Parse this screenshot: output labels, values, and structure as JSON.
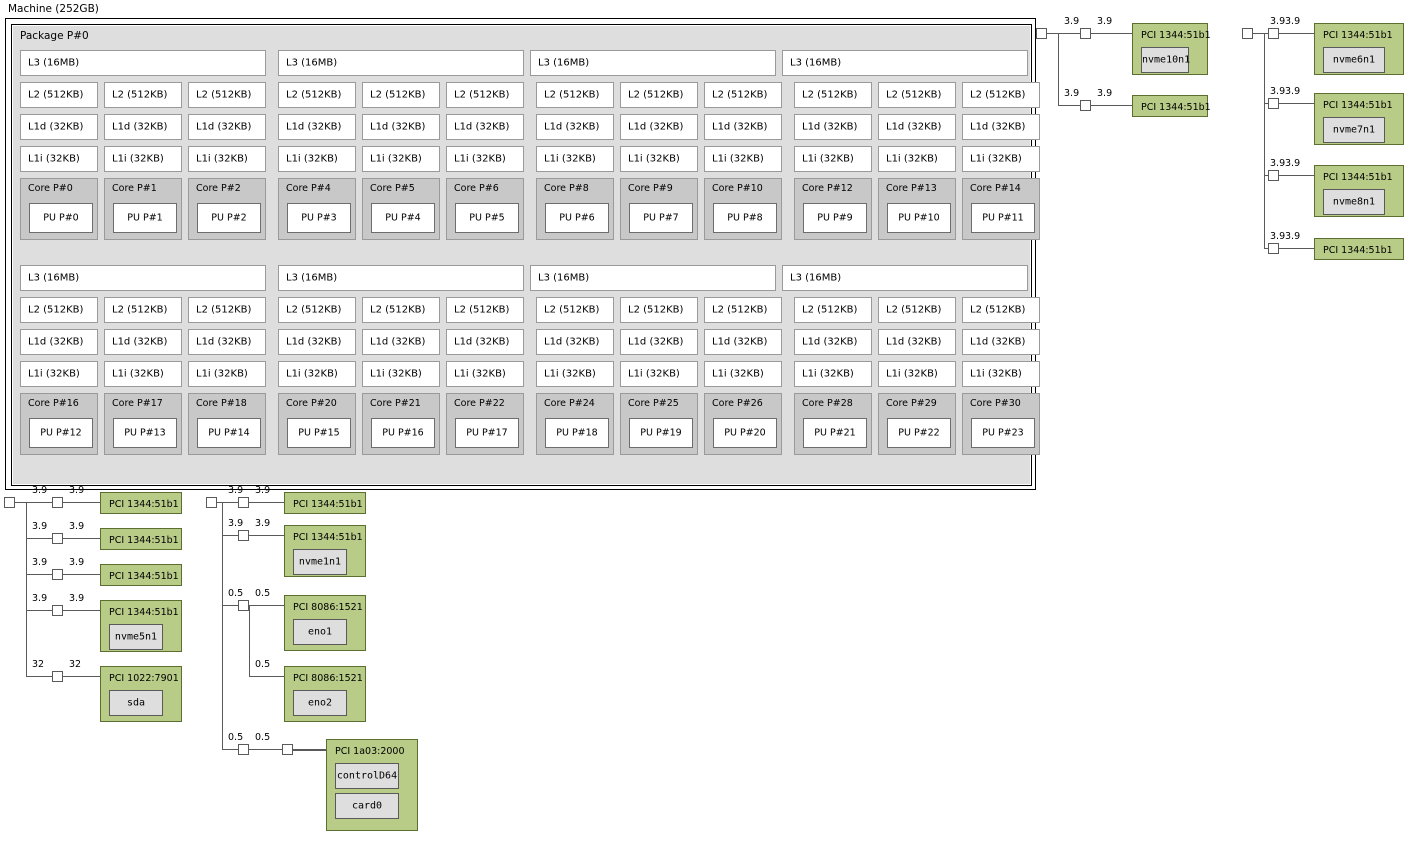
{
  "machine": {
    "label": "Machine (252GB)",
    "package_label": "Package P#0",
    "l3_label": "L3 (16MB)",
    "l2_label": "L2 (512KB)",
    "l1d_label": "L1d (32KB)",
    "l1i_label": "L1i (32KB)",
    "l3_count_per_row": 4,
    "rows": [
      {
        "cores": [
          {
            "core": "Core P#0",
            "pu": "PU P#0"
          },
          {
            "core": "Core P#1",
            "pu": "PU P#1"
          },
          {
            "core": "Core P#2",
            "pu": "PU P#2"
          },
          {
            "core": "Core P#4",
            "pu": "PU P#3"
          },
          {
            "core": "Core P#5",
            "pu": "PU P#4"
          },
          {
            "core": "Core P#6",
            "pu": "PU P#5"
          },
          {
            "core": "Core P#8",
            "pu": "PU P#6"
          },
          {
            "core": "Core P#9",
            "pu": "PU P#7"
          },
          {
            "core": "Core P#10",
            "pu": "PU P#8"
          },
          {
            "core": "Core P#12",
            "pu": "PU P#9"
          },
          {
            "core": "Core P#13",
            "pu": "PU P#10"
          },
          {
            "core": "Core P#14",
            "pu": "PU P#11"
          }
        ]
      },
      {
        "cores": [
          {
            "core": "Core P#16",
            "pu": "PU P#12"
          },
          {
            "core": "Core P#17",
            "pu": "PU P#13"
          },
          {
            "core": "Core P#18",
            "pu": "PU P#14"
          },
          {
            "core": "Core P#20",
            "pu": "PU P#15"
          },
          {
            "core": "Core P#21",
            "pu": "PU P#16"
          },
          {
            "core": "Core P#22",
            "pu": "PU P#17"
          },
          {
            "core": "Core P#24",
            "pu": "PU P#18"
          },
          {
            "core": "Core P#25",
            "pu": "PU P#19"
          },
          {
            "core": "Core P#26",
            "pu": "PU P#20"
          },
          {
            "core": "Core P#28",
            "pu": "PU P#21"
          },
          {
            "core": "Core P#29",
            "pu": "PU P#22"
          },
          {
            "core": "Core P#30",
            "pu": "PU P#23"
          }
        ]
      }
    ]
  },
  "io_trees": {
    "tree_a": {
      "branches": [
        {
          "bw_left": "3.9",
          "bw_right": "3.9",
          "pci": "PCI 1344:51b1",
          "osdev": [
            "nvme10n1"
          ]
        },
        {
          "bw_left": "3.9",
          "bw_right": "3.9",
          "pci": "PCI 1344:51b1",
          "osdev": []
        }
      ]
    },
    "tree_b": {
      "branches": [
        {
          "bw_left": "3.9",
          "bw_right": "3.9",
          "pci": "PCI 1344:51b1",
          "osdev": [
            "nvme6n1"
          ]
        },
        {
          "bw_left": "3.9",
          "bw_right": "3.9",
          "pci": "PCI 1344:51b1",
          "osdev": [
            "nvme7n1"
          ]
        },
        {
          "bw_left": "3.9",
          "bw_right": "3.9",
          "pci": "PCI 1344:51b1",
          "osdev": [
            "nvme8n1"
          ]
        },
        {
          "bw_left": "3.9",
          "bw_right": "3.9",
          "pci": "PCI 1344:51b1",
          "osdev": []
        }
      ]
    },
    "tree_c": {
      "branches": [
        {
          "bw_left": "3.9",
          "bw_right": "3.9",
          "pci": "PCI 1344:51b1",
          "osdev": []
        },
        {
          "bw_left": "3.9",
          "bw_right": "3.9",
          "pci": "PCI 1344:51b1",
          "osdev": []
        },
        {
          "bw_left": "3.9",
          "bw_right": "3.9",
          "pci": "PCI 1344:51b1",
          "osdev": []
        },
        {
          "bw_left": "3.9",
          "bw_right": "3.9",
          "pci": "PCI 1344:51b1",
          "osdev": [
            "nvme5n1"
          ]
        },
        {
          "bw_left": "32",
          "bw_right": "32",
          "pci": "PCI 1022:7901",
          "osdev": [
            "sda"
          ]
        }
      ]
    },
    "tree_d": {
      "branches": [
        {
          "bw_left": "3.9",
          "bw_right": "3.9",
          "pci": "PCI 1344:51b1",
          "osdev": []
        },
        {
          "bw_left": "3.9",
          "bw_right": "3.9",
          "pci": "PCI 1344:51b1",
          "osdev": [
            "nvme1n1"
          ]
        },
        {
          "bw_left": "0.5",
          "bw_right": "0.5",
          "pci": "PCI 8086:1521",
          "osdev": [
            "eno1"
          ]
        },
        {
          "bw_left": "",
          "bw_right": "0.5",
          "pci": "PCI 8086:1521",
          "osdev": [
            "eno2"
          ]
        },
        {
          "bw_left": "0.5",
          "bw_right": "0.5",
          "pci": "PCI 1a03:2000",
          "osdev": [
            "controlD64",
            "card0"
          ]
        }
      ]
    }
  },
  "colors": {
    "package_bg": "#dedede",
    "core_bg": "#c8c8c8",
    "pci_bg": "#b8cc88",
    "pci_border": "#5b7030",
    "osdev_bg": "#dedede",
    "line": "#5a5a5a",
    "box_bg": "#ffffff"
  }
}
